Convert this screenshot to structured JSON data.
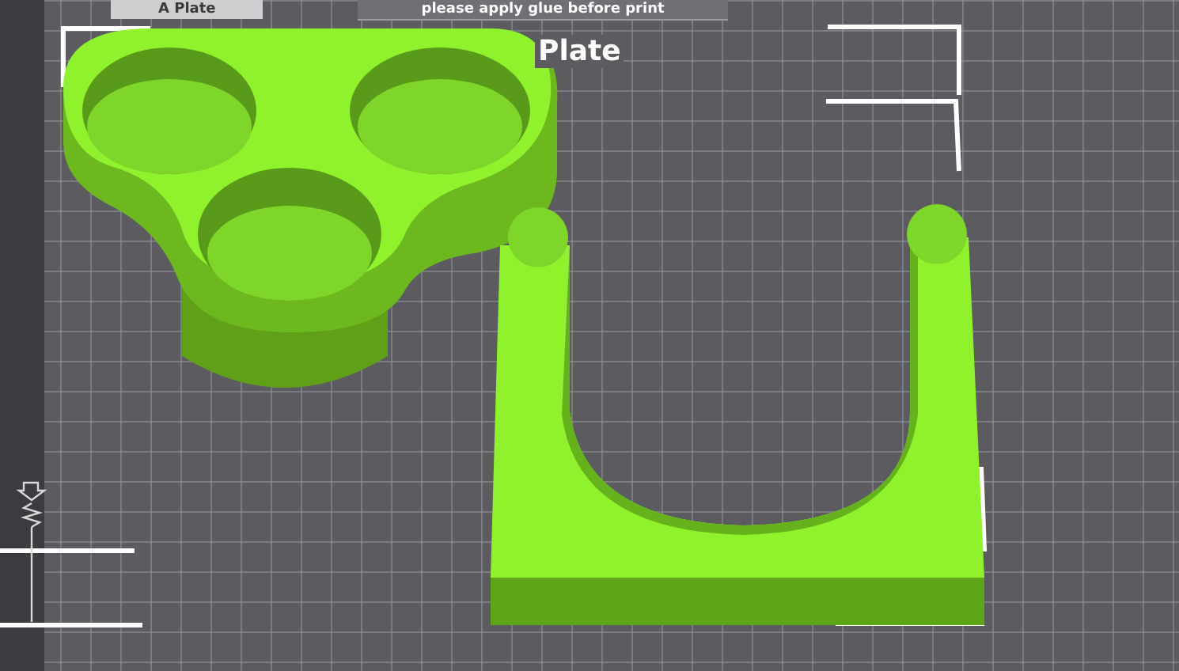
{
  "plate_tab": {
    "label": "A Plate"
  },
  "notice": {
    "text": "please apply glue before print"
  },
  "plate": {
    "label": "Plate"
  }
}
